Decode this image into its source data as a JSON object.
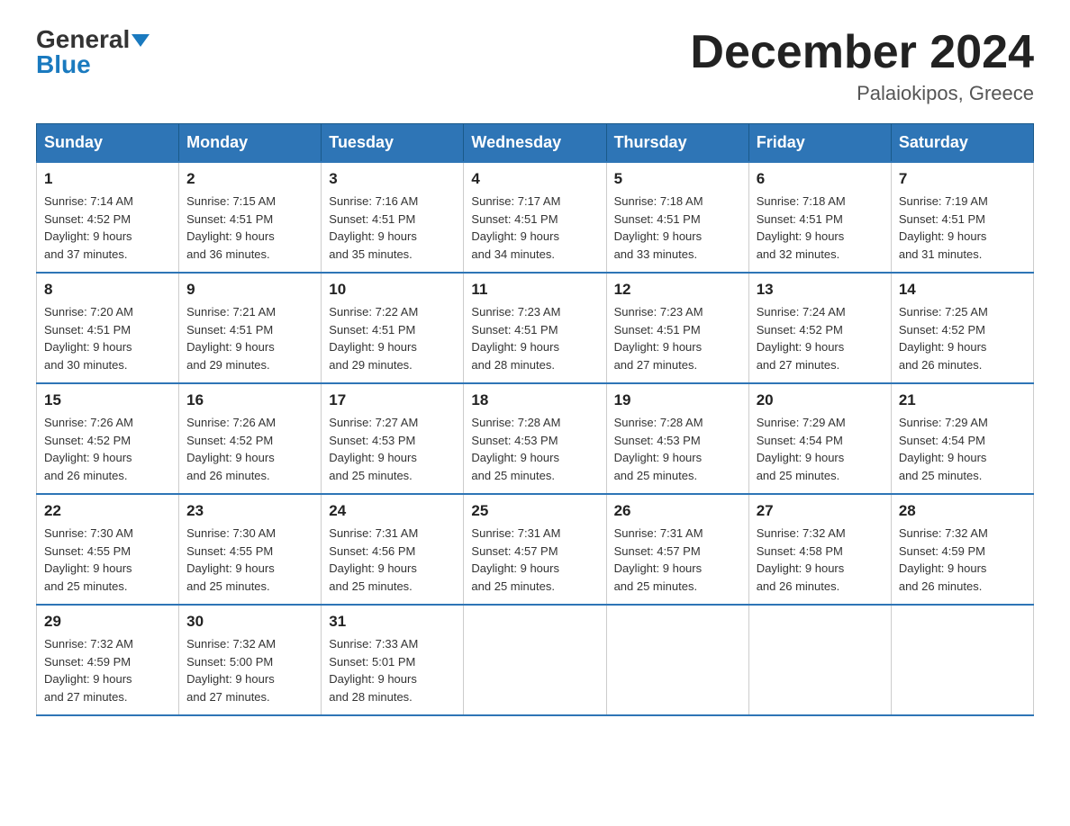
{
  "logo": {
    "general": "General",
    "blue": "Blue"
  },
  "title": "December 2024",
  "location": "Palaiokipos, Greece",
  "headers": [
    "Sunday",
    "Monday",
    "Tuesday",
    "Wednesday",
    "Thursday",
    "Friday",
    "Saturday"
  ],
  "weeks": [
    [
      {
        "day": "1",
        "sunrise": "7:14 AM",
        "sunset": "4:52 PM",
        "daylight": "9 hours and 37 minutes."
      },
      {
        "day": "2",
        "sunrise": "7:15 AM",
        "sunset": "4:51 PM",
        "daylight": "9 hours and 36 minutes."
      },
      {
        "day": "3",
        "sunrise": "7:16 AM",
        "sunset": "4:51 PM",
        "daylight": "9 hours and 35 minutes."
      },
      {
        "day": "4",
        "sunrise": "7:17 AM",
        "sunset": "4:51 PM",
        "daylight": "9 hours and 34 minutes."
      },
      {
        "day": "5",
        "sunrise": "7:18 AM",
        "sunset": "4:51 PM",
        "daylight": "9 hours and 33 minutes."
      },
      {
        "day": "6",
        "sunrise": "7:18 AM",
        "sunset": "4:51 PM",
        "daylight": "9 hours and 32 minutes."
      },
      {
        "day": "7",
        "sunrise": "7:19 AM",
        "sunset": "4:51 PM",
        "daylight": "9 hours and 31 minutes."
      }
    ],
    [
      {
        "day": "8",
        "sunrise": "7:20 AM",
        "sunset": "4:51 PM",
        "daylight": "9 hours and 30 minutes."
      },
      {
        "day": "9",
        "sunrise": "7:21 AM",
        "sunset": "4:51 PM",
        "daylight": "9 hours and 29 minutes."
      },
      {
        "day": "10",
        "sunrise": "7:22 AM",
        "sunset": "4:51 PM",
        "daylight": "9 hours and 29 minutes."
      },
      {
        "day": "11",
        "sunrise": "7:23 AM",
        "sunset": "4:51 PM",
        "daylight": "9 hours and 28 minutes."
      },
      {
        "day": "12",
        "sunrise": "7:23 AM",
        "sunset": "4:51 PM",
        "daylight": "9 hours and 27 minutes."
      },
      {
        "day": "13",
        "sunrise": "7:24 AM",
        "sunset": "4:52 PM",
        "daylight": "9 hours and 27 minutes."
      },
      {
        "day": "14",
        "sunrise": "7:25 AM",
        "sunset": "4:52 PM",
        "daylight": "9 hours and 26 minutes."
      }
    ],
    [
      {
        "day": "15",
        "sunrise": "7:26 AM",
        "sunset": "4:52 PM",
        "daylight": "9 hours and 26 minutes."
      },
      {
        "day": "16",
        "sunrise": "7:26 AM",
        "sunset": "4:52 PM",
        "daylight": "9 hours and 26 minutes."
      },
      {
        "day": "17",
        "sunrise": "7:27 AM",
        "sunset": "4:53 PM",
        "daylight": "9 hours and 25 minutes."
      },
      {
        "day": "18",
        "sunrise": "7:28 AM",
        "sunset": "4:53 PM",
        "daylight": "9 hours and 25 minutes."
      },
      {
        "day": "19",
        "sunrise": "7:28 AM",
        "sunset": "4:53 PM",
        "daylight": "9 hours and 25 minutes."
      },
      {
        "day": "20",
        "sunrise": "7:29 AM",
        "sunset": "4:54 PM",
        "daylight": "9 hours and 25 minutes."
      },
      {
        "day": "21",
        "sunrise": "7:29 AM",
        "sunset": "4:54 PM",
        "daylight": "9 hours and 25 minutes."
      }
    ],
    [
      {
        "day": "22",
        "sunrise": "7:30 AM",
        "sunset": "4:55 PM",
        "daylight": "9 hours and 25 minutes."
      },
      {
        "day": "23",
        "sunrise": "7:30 AM",
        "sunset": "4:55 PM",
        "daylight": "9 hours and 25 minutes."
      },
      {
        "day": "24",
        "sunrise": "7:31 AM",
        "sunset": "4:56 PM",
        "daylight": "9 hours and 25 minutes."
      },
      {
        "day": "25",
        "sunrise": "7:31 AM",
        "sunset": "4:57 PM",
        "daylight": "9 hours and 25 minutes."
      },
      {
        "day": "26",
        "sunrise": "7:31 AM",
        "sunset": "4:57 PM",
        "daylight": "9 hours and 25 minutes."
      },
      {
        "day": "27",
        "sunrise": "7:32 AM",
        "sunset": "4:58 PM",
        "daylight": "9 hours and 26 minutes."
      },
      {
        "day": "28",
        "sunrise": "7:32 AM",
        "sunset": "4:59 PM",
        "daylight": "9 hours and 26 minutes."
      }
    ],
    [
      {
        "day": "29",
        "sunrise": "7:32 AM",
        "sunset": "4:59 PM",
        "daylight": "9 hours and 27 minutes."
      },
      {
        "day": "30",
        "sunrise": "7:32 AM",
        "sunset": "5:00 PM",
        "daylight": "9 hours and 27 minutes."
      },
      {
        "day": "31",
        "sunrise": "7:33 AM",
        "sunset": "5:01 PM",
        "daylight": "9 hours and 28 minutes."
      },
      null,
      null,
      null,
      null
    ]
  ]
}
